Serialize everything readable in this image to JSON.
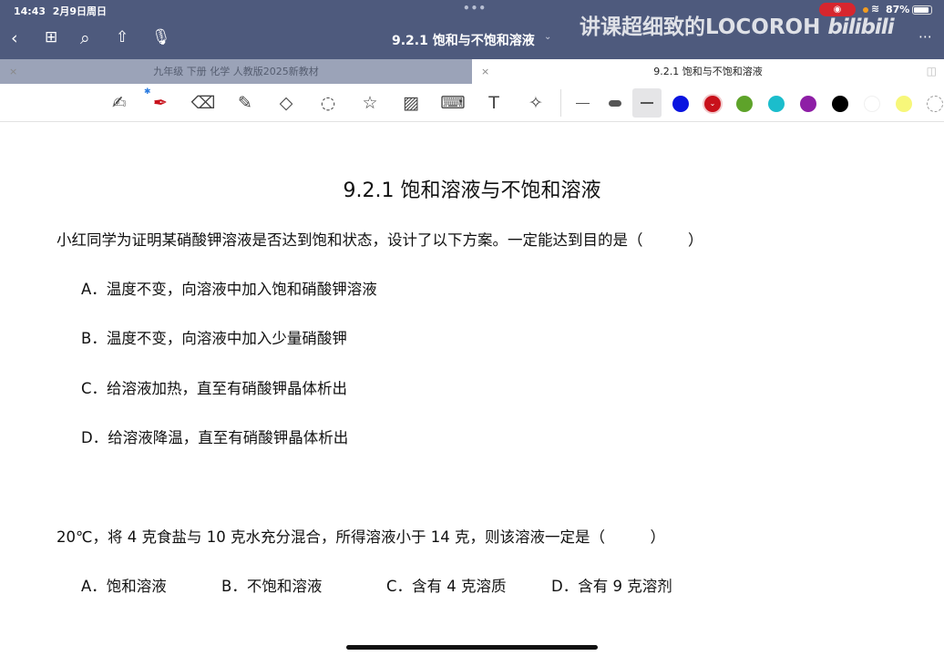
{
  "status": {
    "time": "14:43",
    "date": "2月9日周日",
    "battery": "87%",
    "battery_level": 0.87
  },
  "nav": {
    "title": "9.2.1 饱和与不饱和溶液"
  },
  "watermark": {
    "text": "讲课超细致的LOCOROH",
    "logo": "bilibili"
  },
  "tabs": [
    {
      "label": "九年级 下册 化学 人教版2025新教材",
      "active": false
    },
    {
      "label": "9.2.1 饱和与不饱和溶液",
      "active": true
    }
  ],
  "toolbar": {
    "colors": [
      "#0a14e0",
      "#c8111b",
      "#5ea32a",
      "#1bbdcc",
      "#8e1ea6",
      "#000000",
      "#ffffff",
      "#f7f77a"
    ],
    "selected_color": "#c8111b"
  },
  "doc": {
    "title": "9.2.1 饱和溶液与不饱和溶液",
    "q1": "小红同学为证明某硝酸钾溶液是否达到饱和状态，设计了以下方案。一定能达到目的是（　　　）",
    "q1_options": [
      "A．温度不变，向溶液中加入饱和硝酸钾溶液",
      "B．温度不变，向溶液中加入少量硝酸钾",
      "C．给溶液加热，直至有硝酸钾晶体析出",
      "D．给溶液降温，直至有硝酸钾晶体析出"
    ],
    "q2": "20℃，将 4 克食盐与 10 克水充分混合，所得溶液小于 14 克，则该溶液一定是（　　　）",
    "q2_options": [
      "A．饱和溶液",
      "B．不饱和溶液",
      "C．含有 4 克溶质",
      "D．含有 9 克溶剂"
    ]
  }
}
